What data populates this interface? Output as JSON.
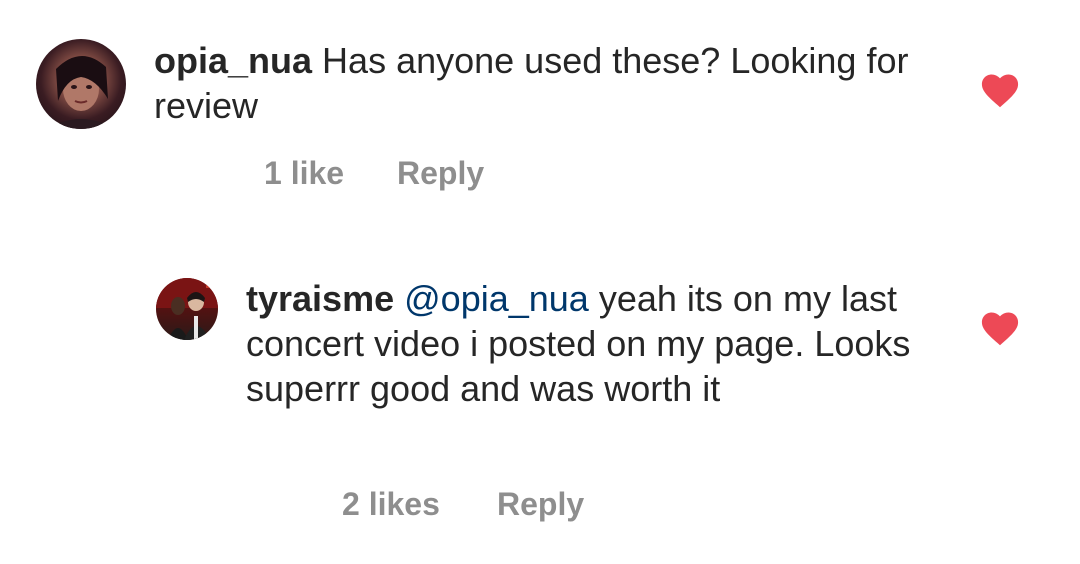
{
  "comments": [
    {
      "username": "opia_nua",
      "text": "Has anyone used these? Looking for review",
      "likes": "1 like",
      "reply_label": "Reply",
      "liked": true
    },
    {
      "username": "tyraisme",
      "mention": "@opia_nua",
      "text": "yeah its on my last concert video i posted on my page. Looks superrr good and was worth it",
      "likes": "2 likes",
      "reply_label": "Reply",
      "liked": true
    }
  ],
  "colors": {
    "heart": "#ed4956",
    "meta": "#8e8e8e",
    "mention": "#00376b",
    "text": "#262626"
  },
  "icons": {
    "like": "heart-icon"
  }
}
